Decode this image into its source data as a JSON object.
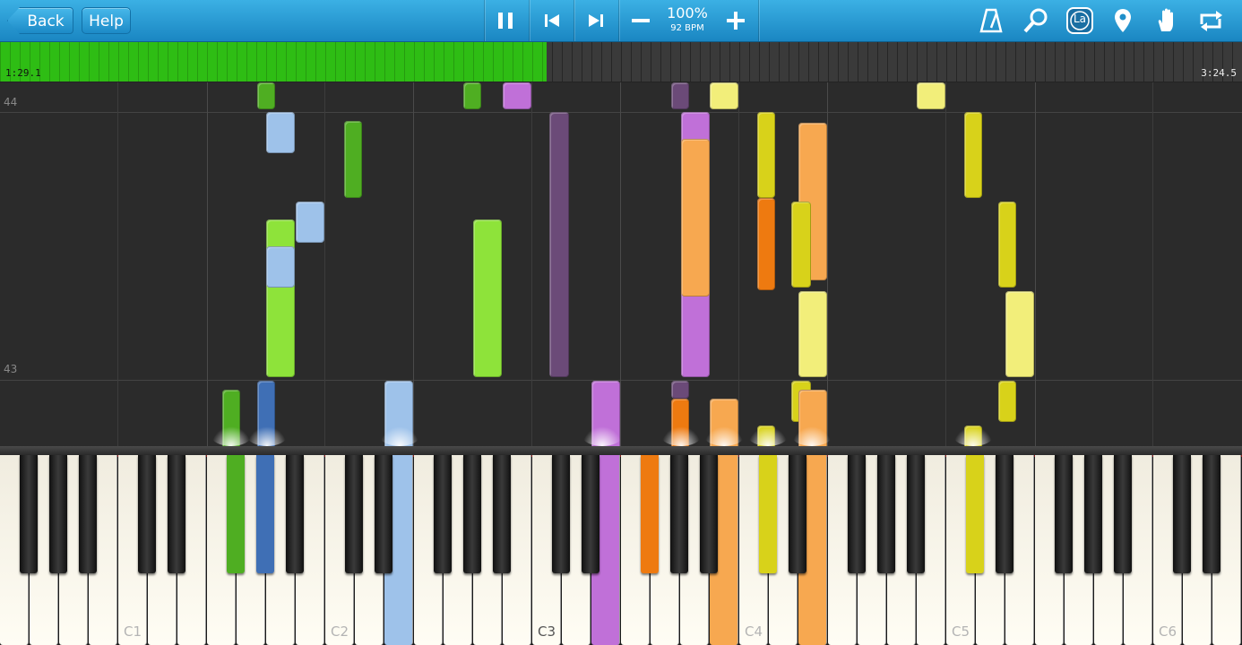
{
  "toolbar": {
    "back_label": "Back",
    "help_label": "Help",
    "zoom": "100%",
    "bpm": "92 BPM",
    "icons": [
      "pause-icon",
      "skip-back-icon",
      "skip-forward-icon",
      "minus-icon",
      "plus-icon",
      "metronome-icon",
      "magnifier-icon",
      "label-la-icon",
      "location-pin-icon",
      "hand-icon",
      "loop-icon"
    ],
    "la_label": "La"
  },
  "progress": {
    "current": "1:29.1",
    "total": "3:24.5",
    "fraction": 0.44
  },
  "roll": {
    "measures": [
      "44",
      "43"
    ]
  },
  "keyboard": {
    "octave_labels": [
      "C1",
      "C2",
      "C3",
      "C4",
      "C5",
      "C6"
    ]
  },
  "colors": {
    "toolbar": "#1f8fca",
    "progress_fill": "#2ebd14",
    "green": "#8ee33a",
    "dark_green": "#4fae22",
    "blue": "#9ec2ea",
    "dark_blue": "#3f6fb5",
    "purple": "#c070d8",
    "dark_purple": "#6b4a78",
    "orange": "#f7a850",
    "dark_orange": "#ee7a10",
    "yellow": "#f2ee7a",
    "dark_yellow": "#d8d21a"
  }
}
